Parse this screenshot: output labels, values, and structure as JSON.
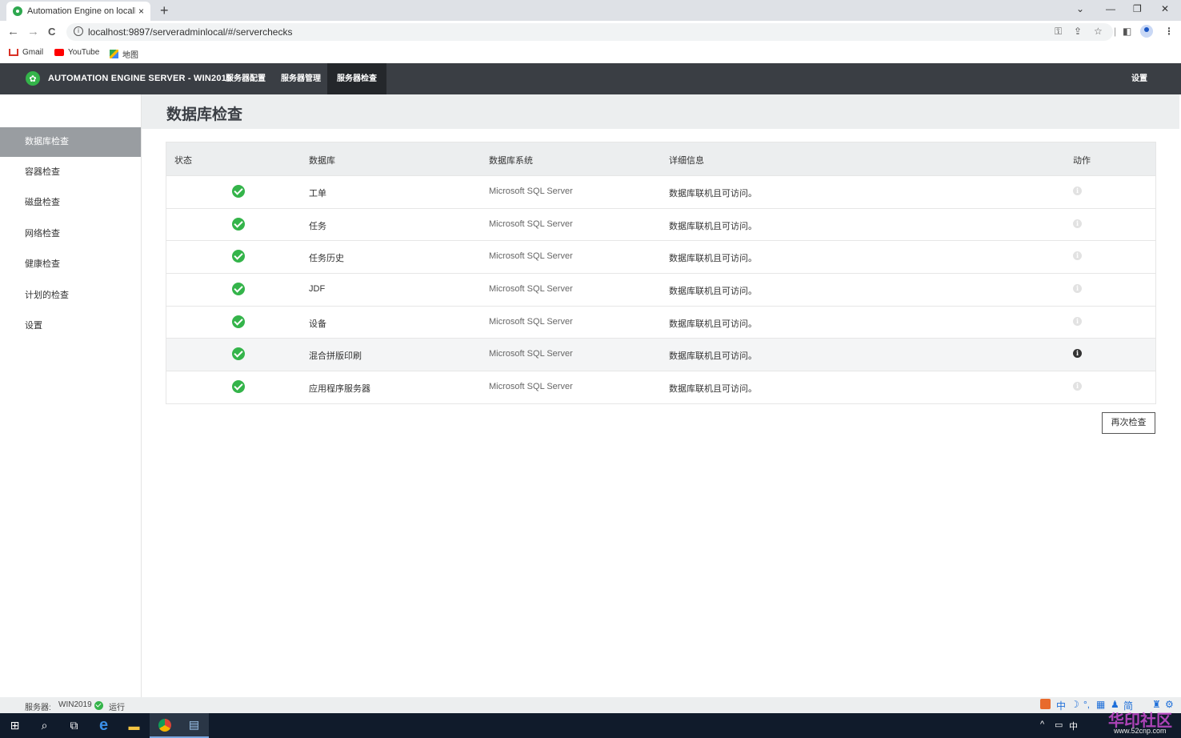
{
  "browser": {
    "tab_title": "Automation Engine on localhc",
    "tab_close": "×",
    "new_tab": "+",
    "window_controls": [
      "⌄",
      "—",
      "❐",
      "✕"
    ],
    "url": "localhost:9897/serveradminlocal/#/serverchecks",
    "nav": [
      "←",
      "→",
      "C"
    ],
    "bookmarks": [
      "Gmail",
      "YouTube",
      "地图"
    ]
  },
  "header": {
    "title": "AUTOMATION ENGINE SERVER - WIN2019",
    "tabs": [
      "服务器配置",
      "服务器管理",
      "服务器检查"
    ],
    "active_tab": "服务器检查",
    "settings": "设置"
  },
  "sidebar": {
    "items": [
      "数据库检查",
      "容器检查",
      "磁盘检查",
      "网络检查",
      "健康检查",
      "计划的检查",
      "设置"
    ],
    "active": "数据库检查"
  },
  "page": {
    "title": "数据库检查"
  },
  "table": {
    "headers": [
      "状态",
      "数据库",
      "数据库系统",
      "详细信息",
      "动作"
    ],
    "rows": [
      {
        "status": "ok",
        "database": "工单",
        "system": "Microsoft SQL Server",
        "details": "数据库联机且可访问。"
      },
      {
        "status": "ok",
        "database": "任务",
        "system": "Microsoft SQL Server",
        "details": "数据库联机且可访问。"
      },
      {
        "status": "ok",
        "database": "任务历史",
        "system": "Microsoft SQL Server",
        "details": "数据库联机且可访问。"
      },
      {
        "status": "ok",
        "database": "JDF",
        "system": "Microsoft SQL Server",
        "details": "数据库联机且可访问。"
      },
      {
        "status": "ok",
        "database": "设备",
        "system": "Microsoft SQL Server",
        "details": "数据库联机且可访问。"
      },
      {
        "status": "ok",
        "database": "混合拼版印刷",
        "system": "Microsoft SQL Server",
        "details": "数据库联机且可访问。"
      },
      {
        "status": "ok",
        "database": "应用程序服务器",
        "system": "Microsoft SQL Server",
        "details": "数据库联机且可访问。"
      }
    ]
  },
  "actions": {
    "recheck": "再次检查"
  },
  "statusbar": {
    "server_label": "服务器:",
    "server_name": "WIN2019",
    "state": "运行"
  },
  "ime": {
    "chars": [
      "中",
      "简"
    ]
  },
  "taskbar": {
    "tray_lang": "中",
    "watermark": "华印社区",
    "watermark_url": "www.52cnp.com"
  },
  "colors": {
    "header_bg": "#3a3e44",
    "accent_green": "#34b44a",
    "sidebar_active": "#999da1"
  }
}
